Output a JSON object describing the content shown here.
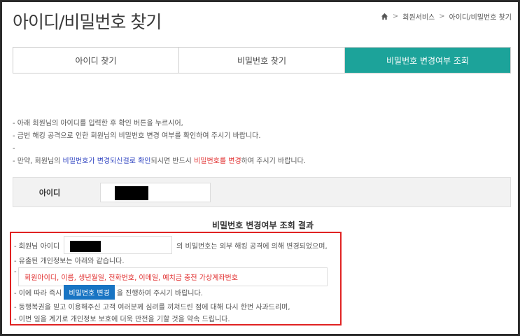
{
  "page": {
    "title": "아이디/비밀번호 찾기"
  },
  "breadcrumb": {
    "home_icon": "home-icon",
    "sep": ">",
    "items": [
      "회원서비스",
      "아이디/비밀번호 찾기"
    ]
  },
  "tabs": [
    {
      "label": "아이디 찾기",
      "active": false
    },
    {
      "label": "비밀번호 찾기",
      "active": false
    },
    {
      "label": "비밀번호 변경여부 조회",
      "active": true
    }
  ],
  "notes": {
    "line1": "- 아래 회원님의 아이디를 입력한 후 확인 버튼을 누르시어,",
    "line2": "- 금번 해킹 공격으로 인한 회원님의 비밀번호 변경 여부를 확인하여 주시기 바랍니다.",
    "line3": "-",
    "line4_prefix": "- 만약, 회원님의 ",
    "line4_blue": "비밀번호가 변경되신걸로 확인",
    "line4_mid": "되시면 반드시 ",
    "line4_red": "비밀번호를 변경",
    "line4_suffix": "하여 주시기 바랍니다."
  },
  "id_form": {
    "label": "아이디",
    "value_redacted": true
  },
  "result": {
    "title": "비밀번호 변경여부 조회 결과",
    "row1_prefix": "- 회원님 아이디",
    "row1_suffix": "의 비밀번호는 외부 해킹 공격에 의해 변경되었으며,",
    "row2": "- 유출된 개인정보는 아래와 같습니다.",
    "row3_dash": "-",
    "leaked_info": "회원아이디, 이름, 생년월일, 전화번호, 이메일, 예치금 충전 가상계좌번호",
    "row4_prefix": "- 이에 따라 즉시",
    "change_button": "비밀번호 변경",
    "row4_suffix": "을 진행하여 주시기 바랍니다.",
    "row5": "- 동행복권을 믿고 이용해주신 고객 여러분께 심려를 끼쳐드린 점에 대해 다시 한번 사과드리며,",
    "row6": "- 이번 일을 계기로 개인정보 보호에 더욱 만전을 기할 것을 약속 드립니다."
  },
  "colors": {
    "accent_teal": "#1ca39a",
    "highlight_red": "#e02222",
    "link_blue": "#2a3fbf",
    "button_blue": "#1874c3"
  }
}
